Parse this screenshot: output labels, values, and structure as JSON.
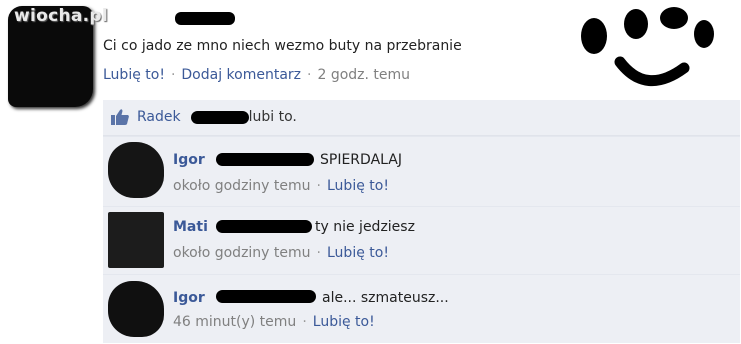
{
  "watermark": "wiocha.pl",
  "post": {
    "text": "Ci co jado ze mno niech wezmo buty na przebranie",
    "like_link": "Lubię to!",
    "comment_link": "Dodaj komentarz",
    "timestamp": "2 godz. temu",
    "separator": "·"
  },
  "likes": {
    "first_name": "Radek",
    "suffix": "lubi to."
  },
  "comments": [
    {
      "name": "Igor",
      "text": "SPIERDALAJ",
      "time": "około godziny temu",
      "like_link": "Lubię to!"
    },
    {
      "name": "Mati",
      "text": "ty nie jedziesz",
      "time": "około godziny temu",
      "like_link": "Lubię to!"
    },
    {
      "name": "Igor",
      "text": "ale... szmateusz...",
      "time": "46 minut(y) temu",
      "like_link": "Lubię to!"
    }
  ],
  "colors": {
    "link": "#3b5998",
    "feedback_bg": "#edeff4",
    "grey_text": "#808080"
  }
}
